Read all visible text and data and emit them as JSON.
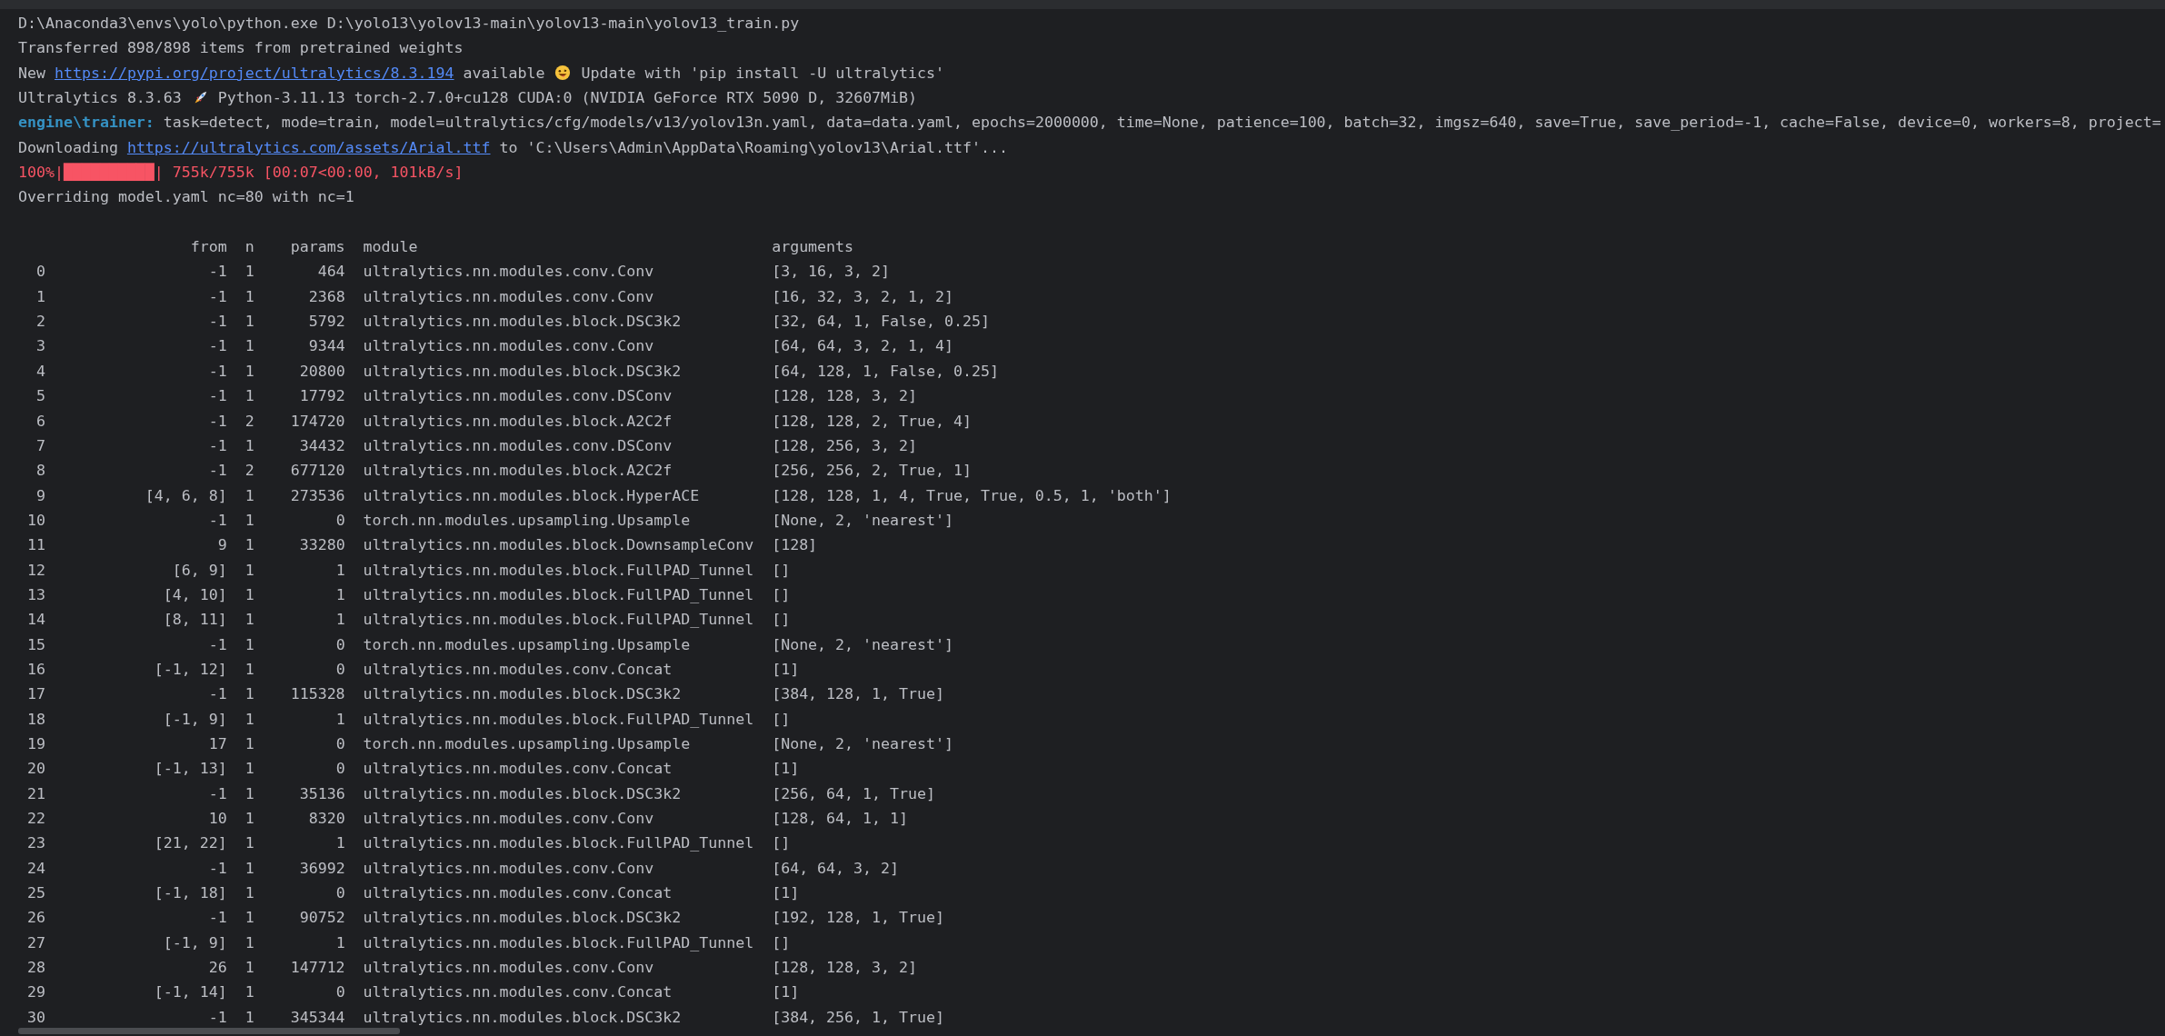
{
  "console": {
    "lines": [
      [
        {
          "kind": "text",
          "text": "D:\\Anaconda3\\envs\\yolo\\python.exe D:\\yolo13\\yolov13-main\\yolov13-main\\yolov13_train.py"
        }
      ],
      [
        {
          "kind": "text",
          "text": "Transferred 898/898 items from pretrained weights"
        }
      ],
      [
        {
          "kind": "text",
          "text": "New "
        },
        {
          "kind": "link",
          "text": "https://pypi.org/project/ultralytics/8.3.194"
        },
        {
          "kind": "text",
          "text": " available "
        },
        {
          "kind": "emoji_face"
        },
        {
          "kind": "text",
          "text": " Update with 'pip install -U ultralytics'"
        }
      ],
      [
        {
          "kind": "text",
          "text": "Ultralytics 8.3.63 "
        },
        {
          "kind": "emoji_rocket"
        },
        {
          "kind": "text",
          "text": " Python-3.11.13 torch-2.7.0+cu128 CUDA:0 (NVIDIA GeForce RTX 5090 D, 32607MiB)"
        }
      ],
      [
        {
          "kind": "label",
          "text": "engine\\trainer:"
        },
        {
          "kind": "text",
          "text": " task=detect, mode=train, model=ultralytics/cfg/models/v13/yolov13n.yaml, data=data.yaml, epochs=2000000, time=None, patience=100, batch=32, imgsz=640, save=True, save_period=-1, cache=False, device=0, workers=8, project="
        }
      ],
      [
        {
          "kind": "text",
          "text": "Downloading "
        },
        {
          "kind": "link",
          "text": "https://ultralytics.com/assets/Arial.ttf"
        },
        {
          "kind": "text",
          "text": " to 'C:\\Users\\Admin\\AppData\\Roaming\\yolov13\\Arial.ttf'..."
        }
      ],
      [
        {
          "kind": "error",
          "text": "100%|██████████| 755k/755k [00:07<00:00, 101kB/s]"
        }
      ],
      [
        {
          "kind": "text",
          "text": "Overriding model.yaml nc=80 with nc=1"
        }
      ]
    ]
  },
  "table": {
    "columns": [
      "",
      "from",
      "n",
      "params",
      "module",
      "arguments"
    ],
    "rows": [
      [
        "0",
        "-1",
        "1",
        "464",
        "ultralytics.nn.modules.conv.Conv",
        "[3, 16, 3, 2]"
      ],
      [
        "1",
        "-1",
        "1",
        "2368",
        "ultralytics.nn.modules.conv.Conv",
        "[16, 32, 3, 2, 1, 2]"
      ],
      [
        "2",
        "-1",
        "1",
        "5792",
        "ultralytics.nn.modules.block.DSC3k2",
        "[32, 64, 1, False, 0.25]"
      ],
      [
        "3",
        "-1",
        "1",
        "9344",
        "ultralytics.nn.modules.conv.Conv",
        "[64, 64, 3, 2, 1, 4]"
      ],
      [
        "4",
        "-1",
        "1",
        "20800",
        "ultralytics.nn.modules.block.DSC3k2",
        "[64, 128, 1, False, 0.25]"
      ],
      [
        "5",
        "-1",
        "1",
        "17792",
        "ultralytics.nn.modules.conv.DSConv",
        "[128, 128, 3, 2]"
      ],
      [
        "6",
        "-1",
        "2",
        "174720",
        "ultralytics.nn.modules.block.A2C2f",
        "[128, 128, 2, True, 4]"
      ],
      [
        "7",
        "-1",
        "1",
        "34432",
        "ultralytics.nn.modules.conv.DSConv",
        "[128, 256, 3, 2]"
      ],
      [
        "8",
        "-1",
        "2",
        "677120",
        "ultralytics.nn.modules.block.A2C2f",
        "[256, 256, 2, True, 1]"
      ],
      [
        "9",
        "[4, 6, 8]",
        "1",
        "273536",
        "ultralytics.nn.modules.block.HyperACE",
        "[128, 128, 1, 4, True, True, 0.5, 1, 'both']"
      ],
      [
        "10",
        "-1",
        "1",
        "0",
        "torch.nn.modules.upsampling.Upsample",
        "[None, 2, 'nearest']"
      ],
      [
        "11",
        "9",
        "1",
        "33280",
        "ultralytics.nn.modules.block.DownsampleConv",
        "[128]"
      ],
      [
        "12",
        "[6, 9]",
        "1",
        "1",
        "ultralytics.nn.modules.block.FullPAD_Tunnel",
        "[]"
      ],
      [
        "13",
        "[4, 10]",
        "1",
        "1",
        "ultralytics.nn.modules.block.FullPAD_Tunnel",
        "[]"
      ],
      [
        "14",
        "[8, 11]",
        "1",
        "1",
        "ultralytics.nn.modules.block.FullPAD_Tunnel",
        "[]"
      ],
      [
        "15",
        "-1",
        "1",
        "0",
        "torch.nn.modules.upsampling.Upsample",
        "[None, 2, 'nearest']"
      ],
      [
        "16",
        "[-1, 12]",
        "1",
        "0",
        "ultralytics.nn.modules.conv.Concat",
        "[1]"
      ],
      [
        "17",
        "-1",
        "1",
        "115328",
        "ultralytics.nn.modules.block.DSC3k2",
        "[384, 128, 1, True]"
      ],
      [
        "18",
        "[-1, 9]",
        "1",
        "1",
        "ultralytics.nn.modules.block.FullPAD_Tunnel",
        "[]"
      ],
      [
        "19",
        "17",
        "1",
        "0",
        "torch.nn.modules.upsampling.Upsample",
        "[None, 2, 'nearest']"
      ],
      [
        "20",
        "[-1, 13]",
        "1",
        "0",
        "ultralytics.nn.modules.conv.Concat",
        "[1]"
      ],
      [
        "21",
        "-1",
        "1",
        "35136",
        "ultralytics.nn.modules.block.DSC3k2",
        "[256, 64, 1, True]"
      ],
      [
        "22",
        "10",
        "1",
        "8320",
        "ultralytics.nn.modules.conv.Conv",
        "[128, 64, 1, 1]"
      ],
      [
        "23",
        "[21, 22]",
        "1",
        "1",
        "ultralytics.nn.modules.block.FullPAD_Tunnel",
        "[]"
      ],
      [
        "24",
        "-1",
        "1",
        "36992",
        "ultralytics.nn.modules.conv.Conv",
        "[64, 64, 3, 2]"
      ],
      [
        "25",
        "[-1, 18]",
        "1",
        "0",
        "ultralytics.nn.modules.conv.Concat",
        "[1]"
      ],
      [
        "26",
        "-1",
        "1",
        "90752",
        "ultralytics.nn.modules.block.DSC3k2",
        "[192, 128, 1, True]"
      ],
      [
        "27",
        "[-1, 9]",
        "1",
        "1",
        "ultralytics.nn.modules.block.FullPAD_Tunnel",
        "[]"
      ],
      [
        "28",
        "26",
        "1",
        "147712",
        "ultralytics.nn.modules.conv.Conv",
        "[128, 128, 3, 2]"
      ],
      [
        "29",
        "[-1, 14]",
        "1",
        "0",
        "ultralytics.nn.modules.conv.Concat",
        "[1]"
      ],
      [
        "30",
        "-1",
        "1",
        "345344",
        "ultralytics.nn.modules.block.DSC3k2",
        "[384, 256, 1, True]"
      ]
    ]
  }
}
